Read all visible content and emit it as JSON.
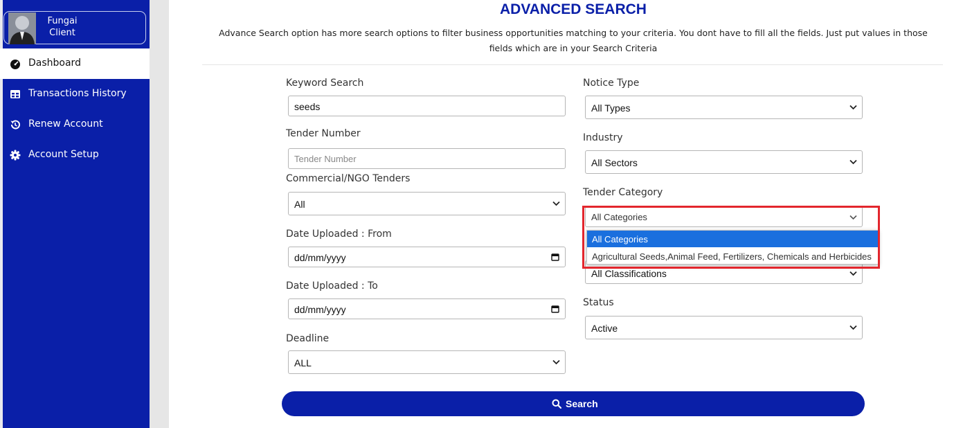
{
  "user": {
    "first_name": "Fungai",
    "last_name": "Client"
  },
  "sidebar": {
    "items": [
      {
        "label": "Dashboard",
        "icon": "tachometer-icon",
        "active": true
      },
      {
        "label": "Transactions History",
        "icon": "table-icon",
        "active": false
      },
      {
        "label": "Renew Account",
        "icon": "history-icon",
        "active": false
      },
      {
        "label": "Account Setup",
        "icon": "gear-icon",
        "active": false
      }
    ]
  },
  "page": {
    "title": "ADVANCED SEARCH",
    "description": "Advance Search option has more search options to filter business opportunities matching to your criteria. You dont have to fill all the fields. Just put values in those fields which are in your Search Criteria"
  },
  "form": {
    "keyword": {
      "label": "Keyword Search",
      "value": "seeds"
    },
    "tender_number": {
      "label": "Tender Number",
      "placeholder": "Tender Number"
    },
    "commercial": {
      "label": "Commercial/NGO Tenders",
      "value": "All"
    },
    "date_from": {
      "label": "Date Uploaded : From",
      "value": "dd/mm/yyyy"
    },
    "date_to": {
      "label": "Date Uploaded : To",
      "value": "dd/mm/yyyy"
    },
    "deadline": {
      "label": "Deadline",
      "value": "ALL"
    },
    "notice_type": {
      "label": "Notice Type",
      "value": "All Types"
    },
    "industry": {
      "label": "Industry",
      "value": "All Sectors"
    },
    "tender_category": {
      "label": "Tender Category",
      "value": "All Categories",
      "options": [
        "All Categories",
        "Agricultural Seeds,Animal Feed, Fertilizers, Chemicals and Herbicides"
      ]
    },
    "classification": {
      "value": "All Classifications"
    },
    "status": {
      "label": "Status",
      "value": "Active"
    },
    "search_button": "Search"
  },
  "colors": {
    "brand": "#0a1fa8",
    "highlight": "#e3262d",
    "selected_option": "#1a6fde"
  }
}
